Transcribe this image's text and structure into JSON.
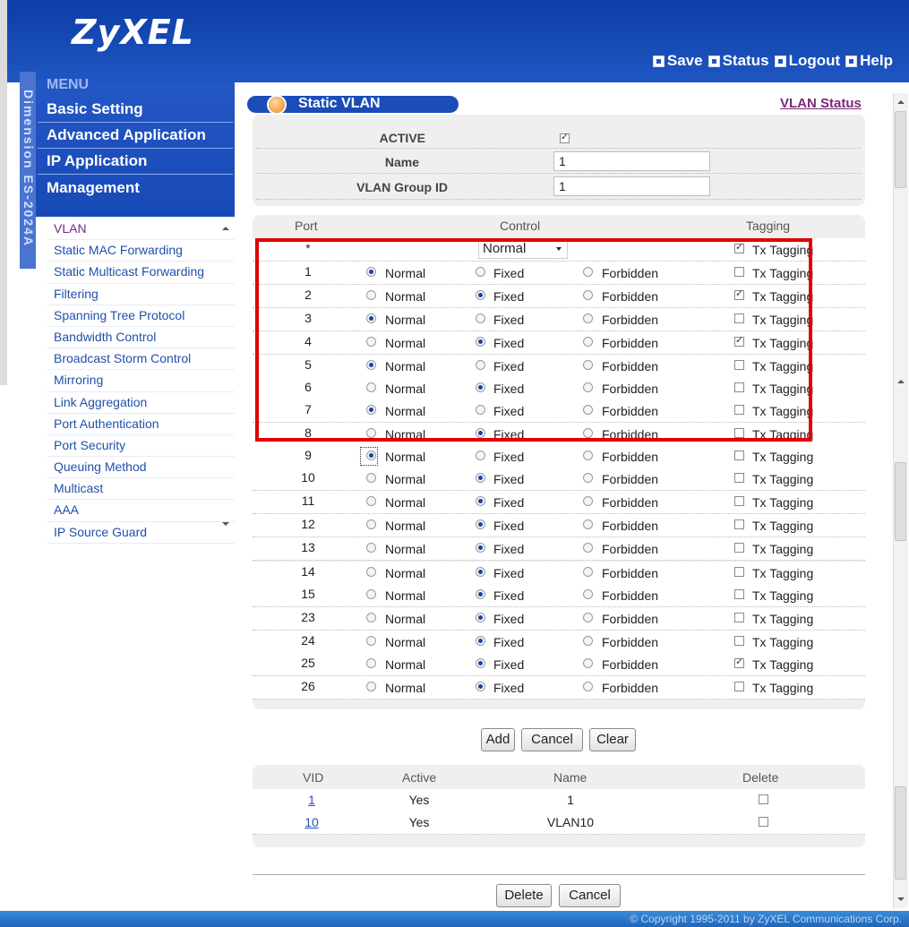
{
  "brand": "ZyXEL",
  "sidebar_vertical": "Dimension ES-2024A",
  "toplinks": [
    "Save",
    "Status",
    "Logout",
    "Help"
  ],
  "menu": {
    "title": "MENU",
    "items": [
      "Basic Setting",
      "Advanced Application",
      "IP Application",
      "Management"
    ],
    "submenu": [
      "VLAN",
      "Static MAC Forwarding",
      "Static Multicast Forwarding",
      "Filtering",
      "Spanning Tree Protocol",
      "Bandwidth Control",
      "Broadcast Storm Control",
      "Mirroring",
      "Link Aggregation",
      "Port Authentication",
      "Port Security",
      "Queuing Method",
      "Multicast",
      "AAA",
      "IP Source Guard"
    ]
  },
  "page": {
    "title": "Static VLAN",
    "status_link": "VLAN Status"
  },
  "form": {
    "active_label": "ACTIVE",
    "active_checked": true,
    "name_label": "Name",
    "name_value": "1",
    "gid_label": "VLAN Group ID",
    "gid_value": "1"
  },
  "ports_table": {
    "headers": {
      "port": "Port",
      "control": "Control",
      "tagging": "Tagging"
    },
    "all_row": {
      "port": "*",
      "control_select": "Normal",
      "tx_label": "Tx Tagging",
      "tx_checked": true
    },
    "option_labels": {
      "normal": "Normal",
      "fixed": "Fixed",
      "forbidden": "Forbidden",
      "tx": "Tx Tagging"
    },
    "rows": [
      {
        "port": "1",
        "control": "normal",
        "tx": false
      },
      {
        "port": "2",
        "control": "fixed",
        "tx": true
      },
      {
        "port": "3",
        "control": "normal",
        "tx": false
      },
      {
        "port": "4",
        "control": "fixed",
        "tx": true
      },
      {
        "port": "5",
        "control": "normal",
        "tx": false
      },
      {
        "port": "6",
        "control": "fixed",
        "tx": false
      },
      {
        "port": "7",
        "control": "normal",
        "tx": false
      },
      {
        "port": "8",
        "control": "fixed",
        "tx": false
      },
      {
        "port": "9",
        "control": "normal",
        "tx": false
      },
      {
        "port": "10",
        "control": "fixed",
        "tx": false
      },
      {
        "port": "11",
        "control": "fixed",
        "tx": false
      },
      {
        "port": "12",
        "control": "fixed",
        "tx": false
      },
      {
        "port": "13",
        "control": "fixed",
        "tx": false
      },
      {
        "port": "14",
        "control": "fixed",
        "tx": false
      },
      {
        "port": "15",
        "control": "fixed",
        "tx": false
      },
      {
        "port": "23",
        "control": "fixed",
        "tx": false
      },
      {
        "port": "24",
        "control": "fixed",
        "tx": false
      },
      {
        "port": "25",
        "control": "fixed",
        "tx": true
      },
      {
        "port": "26",
        "control": "fixed",
        "tx": false
      }
    ]
  },
  "buttons": {
    "add": "Add",
    "cancel": "Cancel",
    "clear": "Clear",
    "delete": "Delete",
    "cancel2": "Cancel"
  },
  "vid_table": {
    "headers": {
      "vid": "VID",
      "active": "Active",
      "name": "Name",
      "delete": "Delete"
    },
    "rows": [
      {
        "vid": "1",
        "active": "Yes",
        "name": "1",
        "delete": false
      },
      {
        "vid": "10",
        "active": "Yes",
        "name": "VLAN10",
        "delete": false
      }
    ]
  },
  "footer": "© Copyright 1995-2011 by ZyXEL Communications Corp."
}
